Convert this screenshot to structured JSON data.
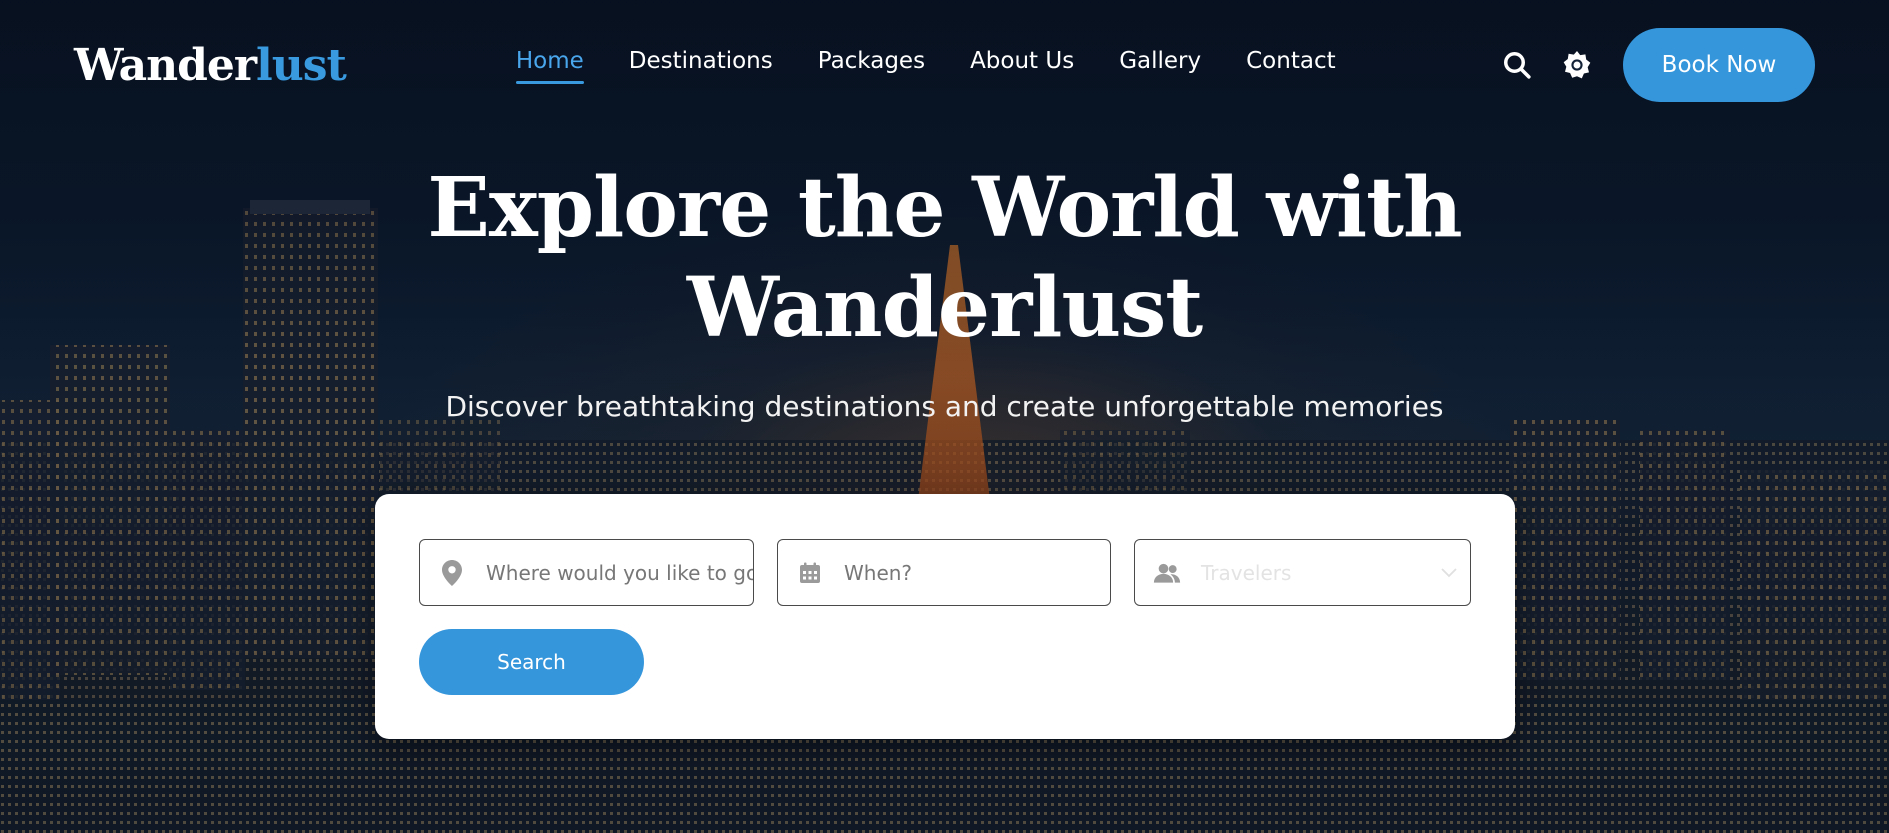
{
  "brand": {
    "name_main": "Wander",
    "name_accent": "lust",
    "accent_color": "#3a9ae0"
  },
  "nav": {
    "items": [
      {
        "label": "Home",
        "active": true
      },
      {
        "label": "Destinations"
      },
      {
        "label": "Packages"
      },
      {
        "label": "About Us"
      },
      {
        "label": "Gallery"
      },
      {
        "label": "Contact"
      }
    ]
  },
  "header": {
    "search_icon": "search-icon",
    "theme_icon": "sun-gear-icon",
    "book_label": "Book Now"
  },
  "hero": {
    "title_line1": "Explore the World with",
    "title_line2": "Wanderlust",
    "subtitle": "Discover breathtaking destinations and create unforgettable memories"
  },
  "search": {
    "destination_placeholder": "Where would you like to go?",
    "date_placeholder": "When?",
    "travelers_placeholder": "Travelers",
    "button_label": "Search",
    "destination_icon": "map-pin-icon",
    "date_icon": "calendar-icon",
    "travelers_icon": "users-icon",
    "button_color": "#3596dc"
  }
}
